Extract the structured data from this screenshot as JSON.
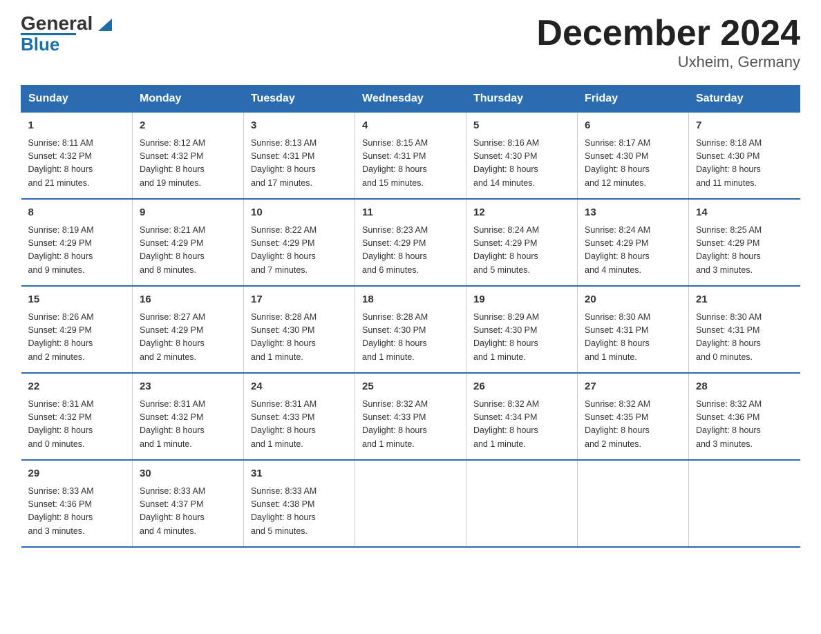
{
  "header": {
    "logo_general": "General",
    "logo_blue": "Blue",
    "month_title": "December 2024",
    "location": "Uxheim, Germany"
  },
  "weekdays": [
    "Sunday",
    "Monday",
    "Tuesday",
    "Wednesday",
    "Thursday",
    "Friday",
    "Saturday"
  ],
  "weeks": [
    [
      {
        "day": "1",
        "info": "Sunrise: 8:11 AM\nSunset: 4:32 PM\nDaylight: 8 hours\nand 21 minutes."
      },
      {
        "day": "2",
        "info": "Sunrise: 8:12 AM\nSunset: 4:32 PM\nDaylight: 8 hours\nand 19 minutes."
      },
      {
        "day": "3",
        "info": "Sunrise: 8:13 AM\nSunset: 4:31 PM\nDaylight: 8 hours\nand 17 minutes."
      },
      {
        "day": "4",
        "info": "Sunrise: 8:15 AM\nSunset: 4:31 PM\nDaylight: 8 hours\nand 15 minutes."
      },
      {
        "day": "5",
        "info": "Sunrise: 8:16 AM\nSunset: 4:30 PM\nDaylight: 8 hours\nand 14 minutes."
      },
      {
        "day": "6",
        "info": "Sunrise: 8:17 AM\nSunset: 4:30 PM\nDaylight: 8 hours\nand 12 minutes."
      },
      {
        "day": "7",
        "info": "Sunrise: 8:18 AM\nSunset: 4:30 PM\nDaylight: 8 hours\nand 11 minutes."
      }
    ],
    [
      {
        "day": "8",
        "info": "Sunrise: 8:19 AM\nSunset: 4:29 PM\nDaylight: 8 hours\nand 9 minutes."
      },
      {
        "day": "9",
        "info": "Sunrise: 8:21 AM\nSunset: 4:29 PM\nDaylight: 8 hours\nand 8 minutes."
      },
      {
        "day": "10",
        "info": "Sunrise: 8:22 AM\nSunset: 4:29 PM\nDaylight: 8 hours\nand 7 minutes."
      },
      {
        "day": "11",
        "info": "Sunrise: 8:23 AM\nSunset: 4:29 PM\nDaylight: 8 hours\nand 6 minutes."
      },
      {
        "day": "12",
        "info": "Sunrise: 8:24 AM\nSunset: 4:29 PM\nDaylight: 8 hours\nand 5 minutes."
      },
      {
        "day": "13",
        "info": "Sunrise: 8:24 AM\nSunset: 4:29 PM\nDaylight: 8 hours\nand 4 minutes."
      },
      {
        "day": "14",
        "info": "Sunrise: 8:25 AM\nSunset: 4:29 PM\nDaylight: 8 hours\nand 3 minutes."
      }
    ],
    [
      {
        "day": "15",
        "info": "Sunrise: 8:26 AM\nSunset: 4:29 PM\nDaylight: 8 hours\nand 2 minutes."
      },
      {
        "day": "16",
        "info": "Sunrise: 8:27 AM\nSunset: 4:29 PM\nDaylight: 8 hours\nand 2 minutes."
      },
      {
        "day": "17",
        "info": "Sunrise: 8:28 AM\nSunset: 4:30 PM\nDaylight: 8 hours\nand 1 minute."
      },
      {
        "day": "18",
        "info": "Sunrise: 8:28 AM\nSunset: 4:30 PM\nDaylight: 8 hours\nand 1 minute."
      },
      {
        "day": "19",
        "info": "Sunrise: 8:29 AM\nSunset: 4:30 PM\nDaylight: 8 hours\nand 1 minute."
      },
      {
        "day": "20",
        "info": "Sunrise: 8:30 AM\nSunset: 4:31 PM\nDaylight: 8 hours\nand 1 minute."
      },
      {
        "day": "21",
        "info": "Sunrise: 8:30 AM\nSunset: 4:31 PM\nDaylight: 8 hours\nand 0 minutes."
      }
    ],
    [
      {
        "day": "22",
        "info": "Sunrise: 8:31 AM\nSunset: 4:32 PM\nDaylight: 8 hours\nand 0 minutes."
      },
      {
        "day": "23",
        "info": "Sunrise: 8:31 AM\nSunset: 4:32 PM\nDaylight: 8 hours\nand 1 minute."
      },
      {
        "day": "24",
        "info": "Sunrise: 8:31 AM\nSunset: 4:33 PM\nDaylight: 8 hours\nand 1 minute."
      },
      {
        "day": "25",
        "info": "Sunrise: 8:32 AM\nSunset: 4:33 PM\nDaylight: 8 hours\nand 1 minute."
      },
      {
        "day": "26",
        "info": "Sunrise: 8:32 AM\nSunset: 4:34 PM\nDaylight: 8 hours\nand 1 minute."
      },
      {
        "day": "27",
        "info": "Sunrise: 8:32 AM\nSunset: 4:35 PM\nDaylight: 8 hours\nand 2 minutes."
      },
      {
        "day": "28",
        "info": "Sunrise: 8:32 AM\nSunset: 4:36 PM\nDaylight: 8 hours\nand 3 minutes."
      }
    ],
    [
      {
        "day": "29",
        "info": "Sunrise: 8:33 AM\nSunset: 4:36 PM\nDaylight: 8 hours\nand 3 minutes."
      },
      {
        "day": "30",
        "info": "Sunrise: 8:33 AM\nSunset: 4:37 PM\nDaylight: 8 hours\nand 4 minutes."
      },
      {
        "day": "31",
        "info": "Sunrise: 8:33 AM\nSunset: 4:38 PM\nDaylight: 8 hours\nand 5 minutes."
      },
      {
        "day": "",
        "info": ""
      },
      {
        "day": "",
        "info": ""
      },
      {
        "day": "",
        "info": ""
      },
      {
        "day": "",
        "info": ""
      }
    ]
  ]
}
